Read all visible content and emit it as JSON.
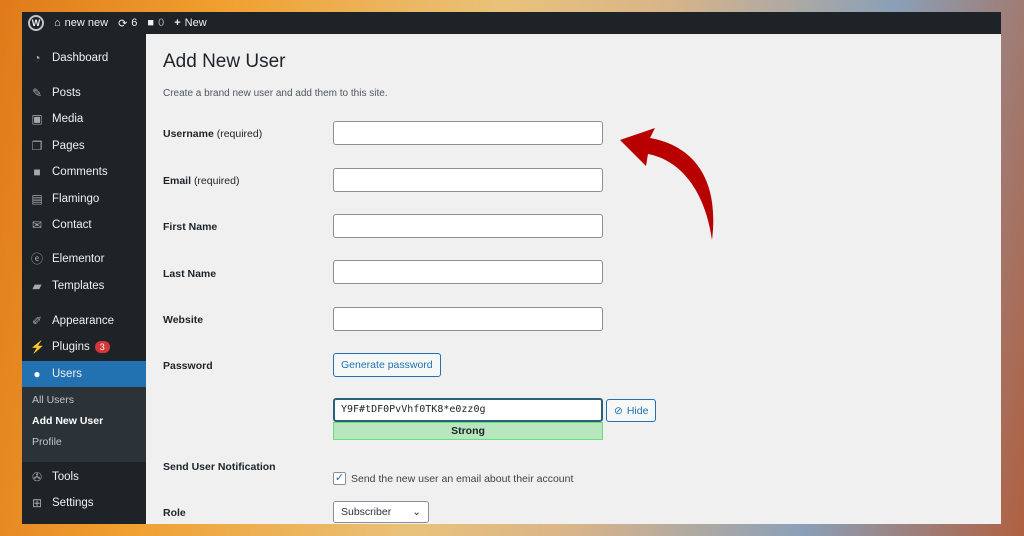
{
  "adminbar": {
    "site": "new new",
    "updates": "6",
    "comments": "0",
    "new": "New"
  },
  "sidebar": {
    "items": [
      {
        "label": "Dashboard",
        "icon": "dashboard-icon"
      },
      {
        "label": "Posts",
        "icon": "pin-icon"
      },
      {
        "label": "Media",
        "icon": "media-icon"
      },
      {
        "label": "Pages",
        "icon": "pages-icon"
      },
      {
        "label": "Comments",
        "icon": "comment-icon"
      },
      {
        "label": "Flamingo",
        "icon": "flamingo-icon"
      },
      {
        "label": "Contact",
        "icon": "mail-icon"
      },
      {
        "label": "Elementor",
        "icon": "elementor-icon"
      },
      {
        "label": "Templates",
        "icon": "folder-icon"
      },
      {
        "label": "Appearance",
        "icon": "brush-icon"
      },
      {
        "label": "Plugins",
        "icon": "plugin-icon",
        "badge": "3"
      },
      {
        "label": "Users",
        "icon": "user-icon"
      },
      {
        "label": "Tools",
        "icon": "wrench-icon"
      },
      {
        "label": "Settings",
        "icon": "settings-icon"
      }
    ],
    "users_sub": [
      "All Users",
      "Add New User",
      "Profile"
    ]
  },
  "page": {
    "title": "Add New User",
    "description": "Create a brand new user and add them to this site."
  },
  "form": {
    "username": "Username",
    "email": "Email",
    "required": "(required)",
    "first_name": "First Name",
    "last_name": "Last Name",
    "website": "Website",
    "password": "Password",
    "generate": "Generate password",
    "password_value": "Y9F#tDF0PvVhf0TK8*e0zz0g",
    "hide": "Hide",
    "strength": "Strong",
    "notification": "Send User Notification",
    "notification_text": "Send the new user an email about their account",
    "notification_checked": true,
    "role": "Role",
    "role_value": "Subscriber"
  },
  "colors": {
    "accent": "#2271b1",
    "arrow": "#c00000",
    "strength": "#b8e6bf"
  }
}
